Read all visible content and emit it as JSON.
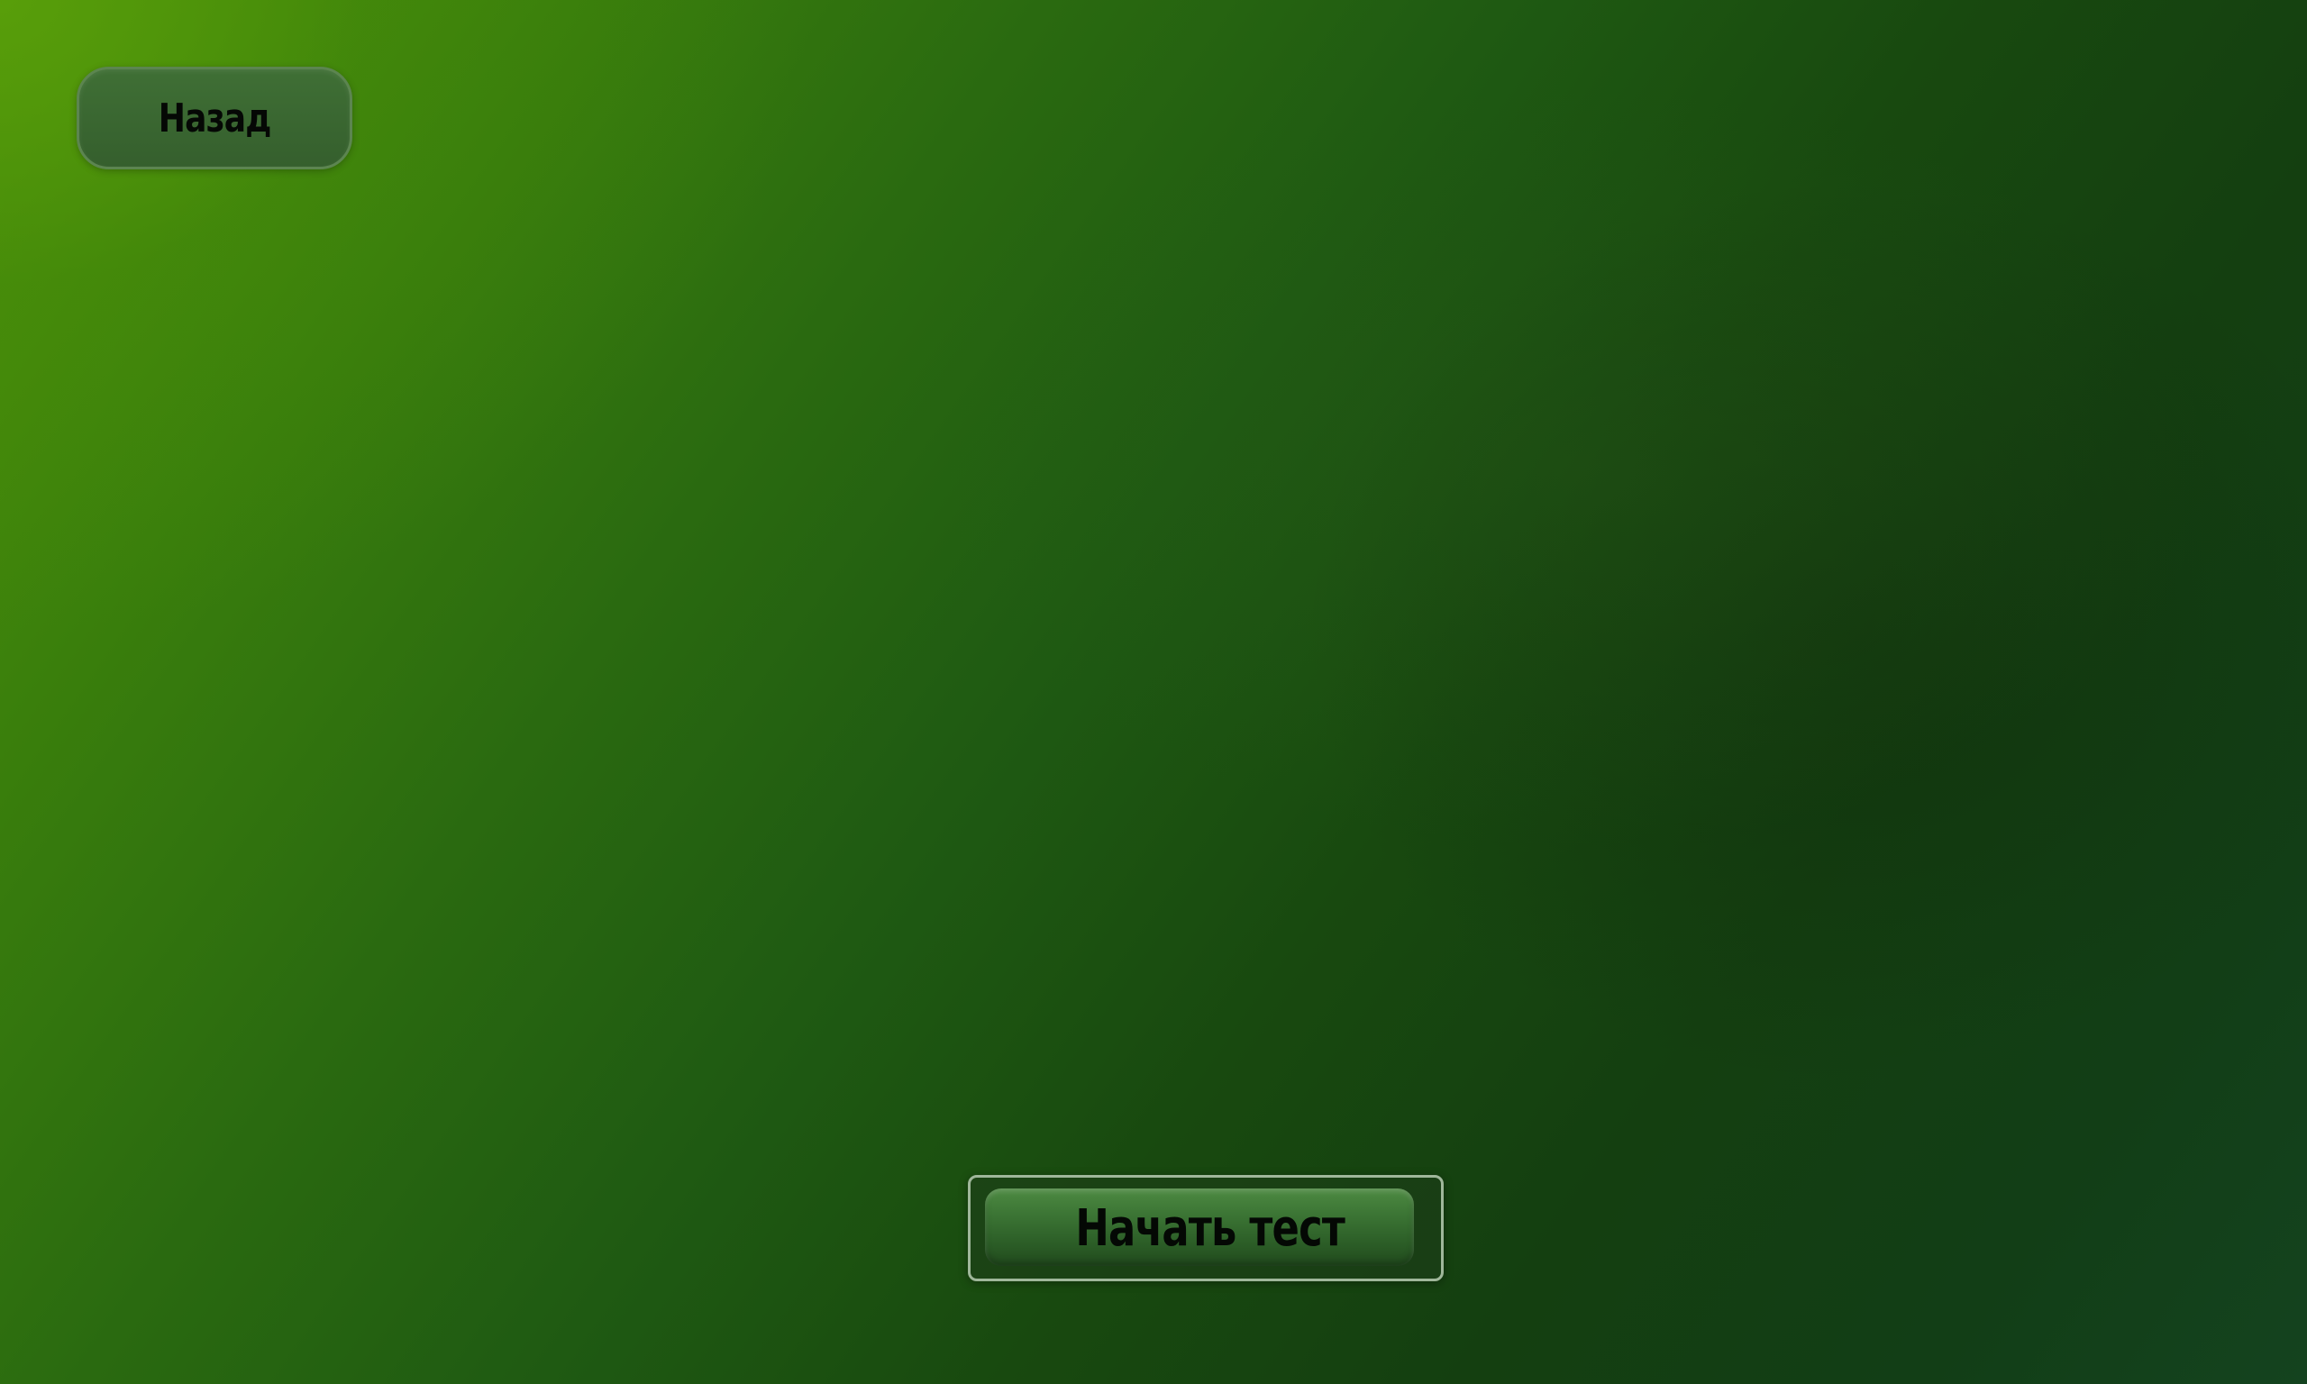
{
  "screen": {
    "background_colors": [
      "#4e9308",
      "#2a6a10",
      "#18490f",
      "#14431f"
    ]
  },
  "back_button": {
    "label": "Назад"
  },
  "start_button": {
    "label": "Начать тест"
  }
}
